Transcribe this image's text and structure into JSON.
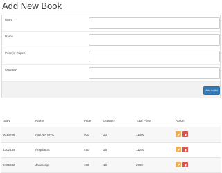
{
  "page": {
    "title": "Add New Book"
  },
  "form": {
    "fields": [
      {
        "label": "ISBN",
        "value": "",
        "placeholder": ""
      },
      {
        "label": "Name",
        "value": "",
        "placeholder": ""
      },
      {
        "label": "Price(in Rupee)",
        "value": "",
        "placeholder": ""
      },
      {
        "label": "Quantity",
        "value": "",
        "placeholder": ""
      }
    ],
    "submit_label": "Add to list"
  },
  "table": {
    "headers": [
      "ISBN",
      "Name",
      "Price",
      "Quantity",
      "Total Price",
      "Action"
    ],
    "rows": [
      {
        "isbn": "9014766",
        "name": "Asp.Net MVC",
        "price": "500",
        "quantity": "20",
        "total": "11000"
      },
      {
        "isbn": "4302134",
        "name": "AngularJS",
        "price": "450",
        "quantity": "25",
        "total": "11250"
      },
      {
        "isbn": "2405632",
        "name": "Javascript",
        "price": "180",
        "quantity": "15",
        "total": "2700"
      }
    ]
  },
  "colors": {
    "primary": "#337ab7",
    "edit": "#f0ad4e",
    "delete": "#d9534f"
  },
  "icons": {
    "edit": "pencil-icon",
    "delete": "trash-icon"
  }
}
